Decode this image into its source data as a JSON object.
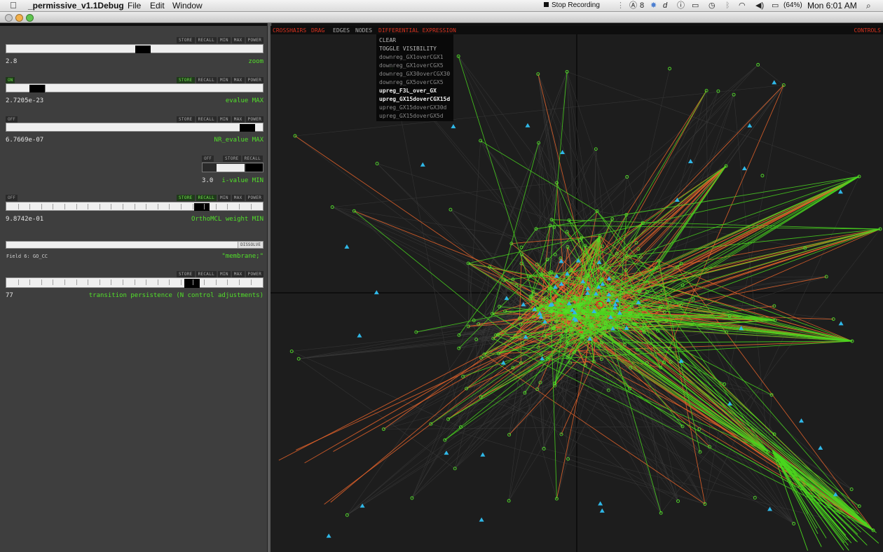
{
  "menubar": {
    "apple": "",
    "app_name": "_permissive_v1.1Debug",
    "menus": [
      "File",
      "Edit",
      "Window"
    ],
    "stop_recording": "Stop Recording",
    "status_badge": "8",
    "battery": "(64%)",
    "clock": "Mon 6:01 AM"
  },
  "sliders": [
    {
      "value": "2.8",
      "label": "zoom",
      "buttons": [
        "STORE",
        "RECALL",
        "MIN",
        "MAX",
        "POWER"
      ],
      "lit": [],
      "knob": 0.535
    },
    {
      "value": "2.7205e-23",
      "label": "evalue MAX",
      "buttons": [
        "STORE",
        "RECALL",
        "MIN",
        "MAX",
        "POWER"
      ],
      "lit": [
        "STORE"
      ],
      "toggle": "ON",
      "knob": 0.095
    },
    {
      "value": "6.7669e-07",
      "label": "NR_evalue MAX",
      "buttons": [
        "STORE",
        "RECALL",
        "MIN",
        "MAX",
        "POWER"
      ],
      "lit": [],
      "toggle": "OFF",
      "knob": 0.97
    },
    {
      "value": "3.0",
      "label": "i-value MIN",
      "buttons": [
        "STORE",
        "RECALL"
      ],
      "lit": [],
      "toggle": "OFF"
    },
    {
      "value": "9.8742e-01",
      "label": "OrthoMCL weight MIN",
      "buttons": [
        "STORE",
        "RECALL",
        "MIN",
        "MAX",
        "POWER"
      ],
      "lit": [
        "STORE",
        "RECALL"
      ],
      "toggle": "OFF",
      "knob": 0.78
    },
    {
      "value": "77",
      "label": "transition persistence (N control adjustments)",
      "buttons": [
        "STORE",
        "RECALL",
        "MIN",
        "MAX",
        "POWER"
      ],
      "lit": [],
      "knob": 0.74
    }
  ],
  "dissolve": {
    "button": "DISSOLVE",
    "field": "Field 6: GO_CC",
    "term": "\"membrane;\""
  },
  "graph_toolbar": {
    "crosshairs": "CROSSHAIRS",
    "drag": "DRAG",
    "edges": "EDGES",
    "nodes": "NODES",
    "diff_expr": "DIFFERENTIAL EXPRESSION",
    "controls": "CONTROLS"
  },
  "diff_menu": {
    "clear": "CLEAR",
    "toggle": "TOGGLE VISIBILITY",
    "options": [
      {
        "label": "downreg_GX1overCGX1",
        "bold": false
      },
      {
        "label": "downreg_GX1overCGX5",
        "bold": false
      },
      {
        "label": "downreg_GX30overCGX30",
        "bold": false
      },
      {
        "label": "downreg_GX5overCGX5",
        "bold": false
      },
      {
        "label": "upreg_F3L_over_GX",
        "bold": true
      },
      {
        "label": "upreg_GX15doverCGX15d",
        "bold": true
      },
      {
        "label": "upreg_GX15doverGX30d",
        "bold": false
      },
      {
        "label": "upreg_GX15doverGX5d",
        "bold": false
      }
    ]
  },
  "colors": {
    "accent_green": "#52e02a",
    "accent_red": "#d9321f",
    "edge_orange": "#e8642a",
    "edge_green": "#49d61e",
    "node_blue": "#2fb8e8",
    "panel_bg": "#3e3e3e"
  }
}
